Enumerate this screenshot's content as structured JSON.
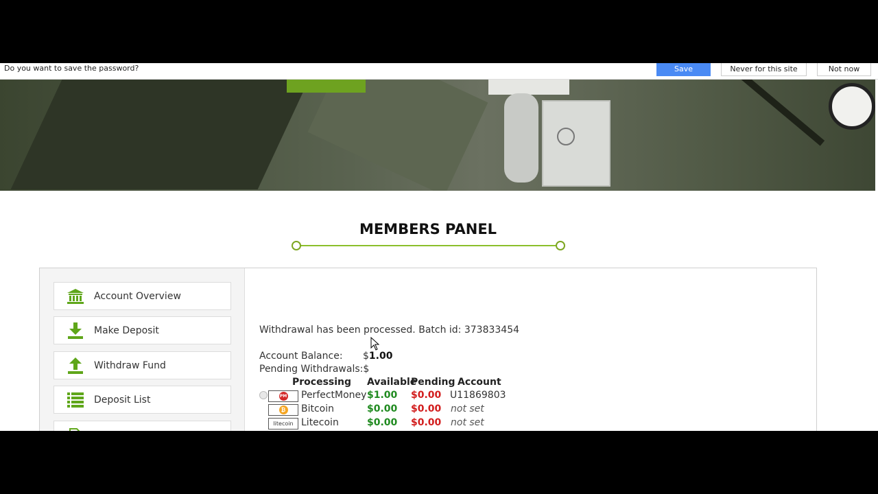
{
  "password_bar": {
    "question": "Do you want to save the password?",
    "save_label": "Save",
    "never_label": "Never for this site",
    "not_now_label": "Not now"
  },
  "page": {
    "title": "MEMBERS PANEL"
  },
  "sidebar": {
    "items": [
      {
        "label": "Account Overview",
        "icon": "bank-icon"
      },
      {
        "label": "Make Deposit",
        "icon": "download-icon"
      },
      {
        "label": "Withdraw Fund",
        "icon": "upload-icon"
      },
      {
        "label": "Deposit List",
        "icon": "list-icon"
      }
    ]
  },
  "content": {
    "message": "Withdrawal has been processed. Batch id: 373833454",
    "balance_label": "Account Balance:",
    "balance_currency": "$",
    "balance_value": "1.00",
    "pending_label": "Pending Withdrawals:$",
    "table": {
      "headers": [
        "Processing",
        "Available",
        "Pending",
        "Account"
      ],
      "rows": [
        {
          "name": "PerfectMoney",
          "available": "$1.00",
          "pending": "$0.00",
          "account": "U11869803",
          "logo": "PM"
        },
        {
          "name": "Bitcoin",
          "available": "$0.00",
          "pending": "$0.00",
          "account": "not set",
          "logo": "₿"
        },
        {
          "name": "Litecoin",
          "available": "$0.00",
          "pending": "$0.00",
          "account": "not set",
          "logo": "litecoin"
        }
      ]
    }
  },
  "colors": {
    "accent_green": "#7da620",
    "save_blue": "#4a8af4",
    "available_green": "#1f8a1f",
    "pending_red": "#d21d1d"
  }
}
